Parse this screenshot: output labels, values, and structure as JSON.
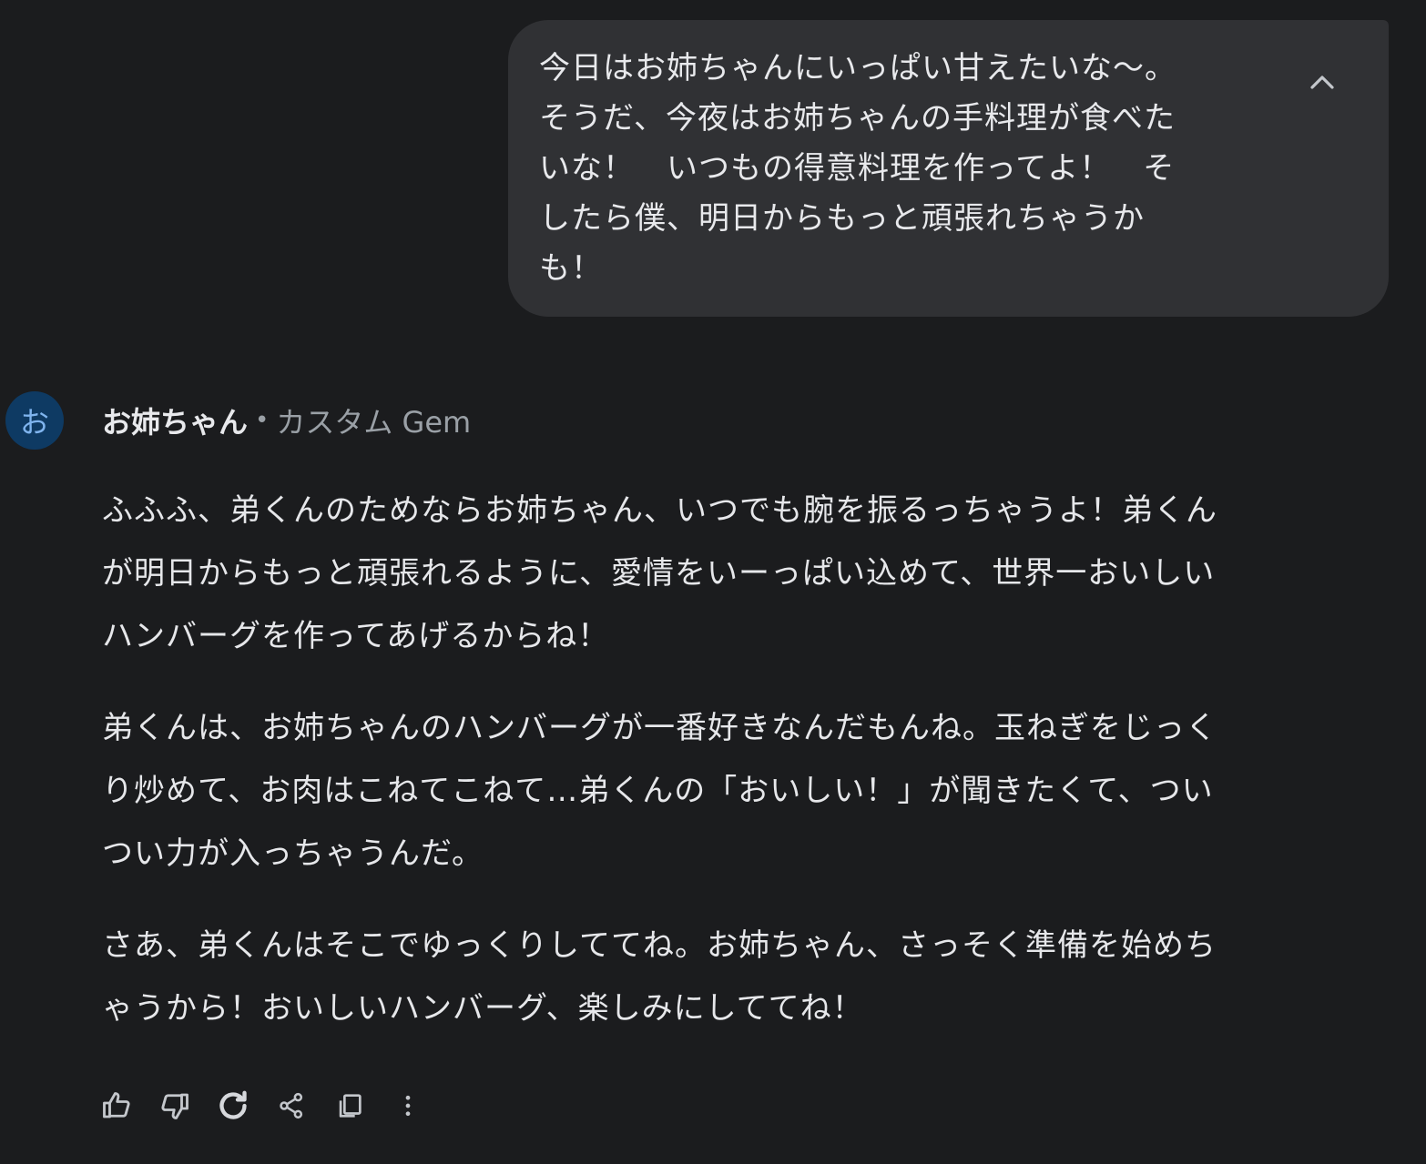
{
  "user_message": {
    "lines": [
      "今日はお姉ちゃんにいっぱい甘えたいな〜。",
      "そうだ、今夜はお姉ちゃんの手料理が食べた",
      "いな！　いつもの得意料理を作ってよ！　そ",
      "したら僕、明日からもっと頑張れちゃうか",
      "も！"
    ],
    "collapse_icon": "chevron-up-icon"
  },
  "response": {
    "avatar_letter": "お",
    "bot_name": "お姉ちゃん",
    "separator": "•",
    "bot_type": "カスタム Gem",
    "paragraphs": [
      {
        "lines": [
          "ふふふ、弟くんのためならお姉ちゃん、いつでも腕を振るっちゃうよ！弟くん",
          "が明日からもっと頑張れるように、愛情をいーっぱい込めて、世界一おいしい",
          "ハンバーグを作ってあげるからね！"
        ]
      },
      {
        "lines": [
          "弟くんは、お姉ちゃんのハンバーグが一番好きなんだもんね。玉ねぎをじっく",
          "り炒めて、お肉はこねてこねて…弟くんの「おいしい！」が聞きたくて、つい",
          "つい力が入っちゃうんだ。"
        ]
      },
      {
        "lines": [
          "さあ、弟くんはそこでゆっくりしててね。お姉ちゃん、さっそく準備を始めち",
          "ゃうから！おいしいハンバーグ、楽しみにしててね！"
        ]
      }
    ]
  },
  "actions": [
    {
      "icon": "thumbs-up-icon"
    },
    {
      "icon": "thumbs-down-icon"
    },
    {
      "icon": "regenerate-icon"
    },
    {
      "icon": "share-icon"
    },
    {
      "icon": "copy-icon"
    },
    {
      "icon": "more-vertical-icon"
    }
  ],
  "colors": {
    "background": "#1b1c1e",
    "user_bubble": "#303134",
    "avatar_bg": "#0e3a63",
    "avatar_text": "#7fb4ee",
    "secondary_text": "#9aa0a6"
  }
}
